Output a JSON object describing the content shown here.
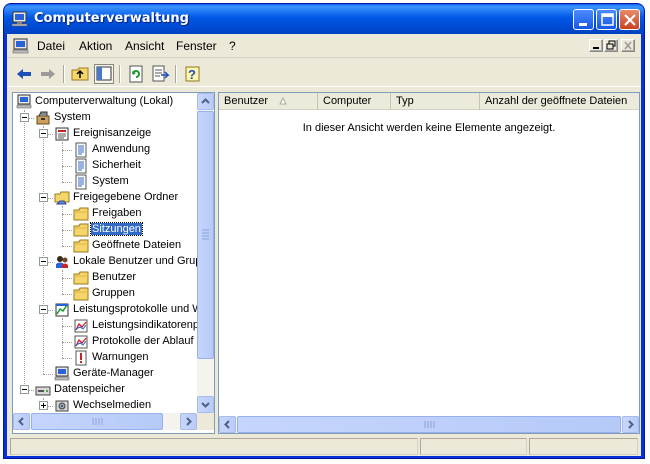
{
  "window": {
    "title": "Computerverwaltung"
  },
  "menu": {
    "items": [
      "Datei",
      "Aktion",
      "Ansicht",
      "Fenster",
      "?"
    ]
  },
  "toolbar": {
    "tools": [
      "back-arrow-icon",
      "forward-arrow-icon",
      "up-folder-icon",
      "show-hide-tree-icon",
      "refresh-icon",
      "export-list-icon",
      "help-icon"
    ],
    "show_hide_tree_pressed": true
  },
  "tree": {
    "selected": "Sitzungen",
    "nodes": [
      {
        "label": "Computerverwaltung (Lokal)",
        "icon": "computer-management-icon"
      },
      {
        "label": "System",
        "icon": "system-tools-icon",
        "expanded": true
      },
      {
        "label": "Ereignisanzeige",
        "icon": "event-viewer-icon",
        "expanded": true
      },
      {
        "label": "Anwendung",
        "icon": "event-log-icon"
      },
      {
        "label": "Sicherheit",
        "icon": "event-log-icon"
      },
      {
        "label": "System",
        "icon": "event-log-icon"
      },
      {
        "label": "Freigegebene Ordner",
        "icon": "shared-folder-icon",
        "expanded": true
      },
      {
        "label": "Freigaben",
        "icon": "folder-icon"
      },
      {
        "label": "Sitzungen",
        "icon": "folder-icon"
      },
      {
        "label": "Geöffnete Dateien",
        "icon": "folder-icon"
      },
      {
        "label": "Lokale Benutzer und Grup",
        "icon": "users-icon",
        "expanded": true
      },
      {
        "label": "Benutzer",
        "icon": "folder-icon"
      },
      {
        "label": "Gruppen",
        "icon": "folder-icon"
      },
      {
        "label": "Leistungsprotokolle und W",
        "icon": "performance-logs-icon",
        "expanded": true
      },
      {
        "label": "Leistungsindikatorenp",
        "icon": "performance-chart-icon"
      },
      {
        "label": "Protokolle der Ablauf",
        "icon": "performance-chart-icon"
      },
      {
        "label": "Warnungen",
        "icon": "alert-icon"
      },
      {
        "label": "Geräte-Manager",
        "icon": "device-manager-icon"
      },
      {
        "label": "Datenspeicher",
        "icon": "storage-icon",
        "expanded": true
      },
      {
        "label": "Wechselmedien",
        "icon": "removable-media-icon",
        "expanded": false
      }
    ]
  },
  "list": {
    "columns": [
      "Benutzer",
      "Computer",
      "Typ",
      "Anzahl der geöffnete Dateien"
    ],
    "sorted_column": "Benutzer",
    "empty_message": "In dieser Ansicht werden keine Elemente angezeigt."
  },
  "colors": {
    "title_bar": "#0058e6",
    "selection": "#316ac5",
    "window_face": "#ece9d8"
  }
}
